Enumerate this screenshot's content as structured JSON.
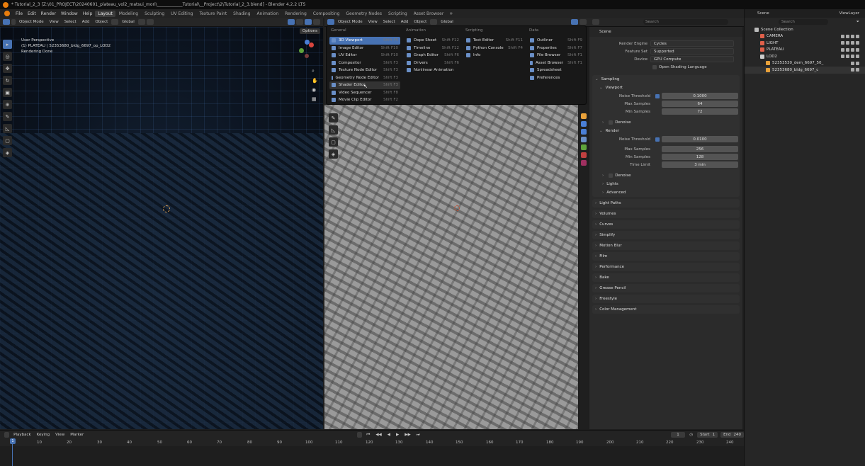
{
  "titlebar": {
    "text": "* Tutorial_2_3 [Z:\\01_PROJECT\\20240601_plateau_vol2_matsui_mori\\____________Tutorial\\__Project\\2\\Tutorial_2_3.blend] - Blender 4.2.2 LTS"
  },
  "menubar": {
    "menus": [
      "File",
      "Edit",
      "Render",
      "Window",
      "Help"
    ],
    "workspaces": [
      "Layout",
      "Modeling",
      "Sculpting",
      "UV Editing",
      "Texture Paint",
      "Shading",
      "Animation",
      "Rendering",
      "Compositing",
      "Geometry Nodes",
      "Scripting",
      "Asset Browser"
    ],
    "active_workspace": "Layout",
    "add_tab": "+"
  },
  "left_header": {
    "mode": "Object Mode",
    "items": [
      "View",
      "Select",
      "Add",
      "Object"
    ],
    "orientation": "Global",
    "options": "Options"
  },
  "left_viewport": {
    "line1": "User Perspective",
    "line2": "(1) PLATEAU | 52353680_bldg_6697_op_LOD2",
    "line3": "Rendering Done"
  },
  "right_header": {
    "mode": "Object Mode",
    "items": [
      "View",
      "Select",
      "Add",
      "Object"
    ],
    "orientation": "Global"
  },
  "editor_menu": {
    "columns": [
      {
        "header": "General",
        "items": [
          {
            "label": "3D Viewport",
            "shortcut": "Shift F5"
          },
          {
            "label": "Image Editor",
            "shortcut": "Shift F10"
          },
          {
            "label": "UV Editor",
            "shortcut": "Shift F10"
          },
          {
            "label": "Compositor",
            "shortcut": "Shift F3"
          },
          {
            "label": "Texture Node Editor",
            "shortcut": "Shift F3"
          },
          {
            "label": "Geometry Node Editor",
            "shortcut": "Shift F3"
          },
          {
            "label": "Shader Editor",
            "shortcut": "Shift F3"
          },
          {
            "label": "Video Sequencer",
            "shortcut": "Shift F8"
          },
          {
            "label": "Movie Clip Editor",
            "shortcut": "Shift F2"
          }
        ]
      },
      {
        "header": "Animation",
        "items": [
          {
            "label": "Dope Sheet",
            "shortcut": "Shift F12"
          },
          {
            "label": "Timeline",
            "shortcut": "Shift F12"
          },
          {
            "label": "Graph Editor",
            "shortcut": "Shift F6"
          },
          {
            "label": "Drivers",
            "shortcut": "Shift F6"
          },
          {
            "label": "Nonlinear Animation",
            "shortcut": ""
          }
        ]
      },
      {
        "header": "Scripting",
        "items": [
          {
            "label": "Text Editor",
            "shortcut": "Shift F11"
          },
          {
            "label": "Python Console",
            "shortcut": "Shift F4"
          },
          {
            "label": "Info",
            "shortcut": ""
          }
        ]
      },
      {
        "header": "Data",
        "items": [
          {
            "label": "Outliner",
            "shortcut": "Shift F9"
          },
          {
            "label": "Properties",
            "shortcut": "Shift F7"
          },
          {
            "label": "File Browser",
            "shortcut": "Shift F1"
          },
          {
            "label": "Asset Browser",
            "shortcut": "Shift F1"
          },
          {
            "label": "Spreadsheet",
            "shortcut": ""
          },
          {
            "label": "Preferences",
            "shortcut": ""
          }
        ]
      }
    ],
    "highlighted": "3D Viewport",
    "hovered": "Shader Editor"
  },
  "properties": {
    "search_placeholder": "Search",
    "context": "Scene",
    "render_engine": {
      "label": "Render Engine",
      "value": "Cycles"
    },
    "feature_set": {
      "label": "Feature Set",
      "value": "Supported"
    },
    "device": {
      "label": "Device",
      "value": "GPU Compute"
    },
    "osl": "Open Shading Language",
    "sampling": "Sampling",
    "viewport": {
      "title": "Viewport",
      "noise_threshold": {
        "label": "Noise Threshold",
        "value": "0.1000"
      },
      "max_samples": {
        "label": "Max Samples",
        "value": "64"
      },
      "min_samples": {
        "label": "Min Samples",
        "value": "72"
      },
      "denoise": "Denoise"
    },
    "render": {
      "title": "Render",
      "noise_threshold": {
        "label": "Noise Threshold",
        "value": "0.0100"
      },
      "max_samples": {
        "label": "Max Samples",
        "value": "256"
      },
      "min_samples": {
        "label": "Min Samples",
        "value": "128"
      },
      "time_limit": {
        "label": "Time Limit",
        "value": "3 min"
      },
      "denoise": "Denoise"
    },
    "lights": "Lights",
    "advanced": "Advanced",
    "panels": [
      "Light Paths",
      "Volumes",
      "Curves",
      "Simplify",
      "Motion Blur",
      "Film",
      "Performance",
      "Bake",
      "Grease Pencil",
      "Freestyle",
      "Color Management"
    ]
  },
  "outliner": {
    "scene": "Scene",
    "view_layer": "ViewLayer",
    "search_placeholder": "Search",
    "root": "Scene Collection",
    "items": [
      {
        "label": "CAMERA",
        "color": "#e0604a",
        "indent": 1
      },
      {
        "label": "LIGHT",
        "color": "#e0604a",
        "indent": 1
      },
      {
        "label": "PLATEAU",
        "color": "#e0604a",
        "indent": 1
      },
      {
        "label": "LOD2",
        "color": "#cccccc",
        "indent": 1
      },
      {
        "label": "52353530_dem_6697_50_",
        "color": "#e8a13a",
        "indent": 2
      },
      {
        "label": "52353680_bldg_6697_c",
        "color": "#e8a13a",
        "indent": 2
      }
    ]
  },
  "timeline": {
    "menus": [
      "Playback",
      "Keying",
      "View",
      "Marker"
    ],
    "current_frame": "1",
    "start_label": "Start",
    "start": "1",
    "end_label": "End",
    "end": "240",
    "ticks": [
      "1",
      "10",
      "20",
      "30",
      "40",
      "50",
      "60",
      "70",
      "80",
      "90",
      "100",
      "110",
      "120",
      "130",
      "140",
      "150",
      "160",
      "170",
      "180",
      "190",
      "200",
      "210",
      "220",
      "230",
      "240"
    ]
  },
  "colors": {
    "accent": "#4772b3",
    "orange": "#e87d0d"
  }
}
